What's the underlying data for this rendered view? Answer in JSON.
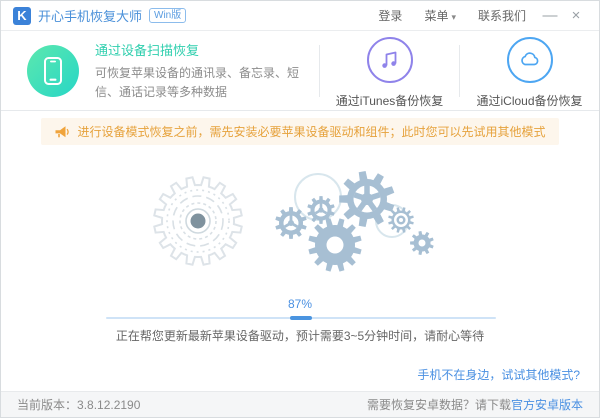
{
  "titlebar": {
    "logo_letter": "K",
    "app_title": "开心手机恢复大师",
    "badge": "Win版",
    "login": "登录",
    "menu": "菜单",
    "contact": "联系我们"
  },
  "icons": {
    "menu_caret": "▾",
    "minimize": "—",
    "close": "×"
  },
  "modes": {
    "device": {
      "title": "通过设备扫描恢复",
      "description": "可恢复苹果设备的通讯录、备忘录、短信、通话记录等多种数据"
    },
    "itunes": {
      "label": "通过iTunes备份恢复"
    },
    "icloud": {
      "label": "通过iCloud备份恢复"
    }
  },
  "notice": {
    "text": "进行设备模式恢复之前，需先安装必要苹果设备驱动和组件；此时您可以先试用其他模式"
  },
  "progress": {
    "percent": "87%",
    "value": 87,
    "status": "正在帮您更新最新苹果设备驱动，预计需要3~5分钟时间，请耐心等待"
  },
  "links": {
    "other_mode": "手机不在身边，试试其他模式?"
  },
  "statusbar": {
    "version_label": "当前版本：",
    "version": "3.8.12.2190",
    "android_prompt": "需要恢复安卓数据？请下载",
    "android_link": "官方安卓版本"
  },
  "colors": {
    "accent_blue": "#4a90e2",
    "brand_blue": "#3b82d8",
    "teal": "#2fcfae",
    "purple": "#8f83ea",
    "icloud_blue": "#4da6f2",
    "notice_orange": "#e6a23c",
    "notice_bg": "#fdf6ec",
    "gear_blue": "#a7bfd3"
  }
}
